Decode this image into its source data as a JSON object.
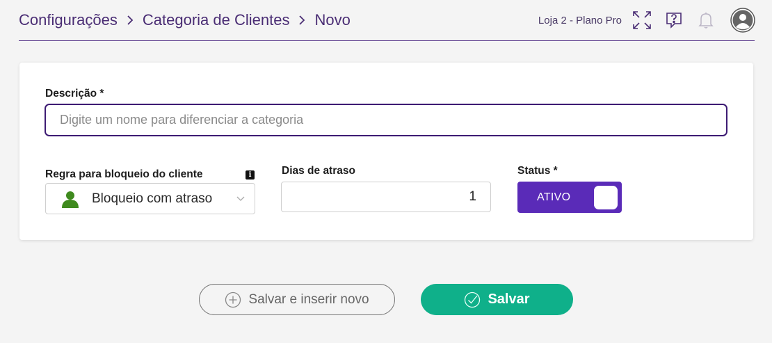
{
  "breadcrumb": {
    "items": [
      "Configurações",
      "Categoria de Clientes",
      "Novo"
    ]
  },
  "header": {
    "store_label": "Loja 2 - Plano Pro",
    "icons": [
      "fullscreen-icon",
      "help-icon",
      "bell-icon",
      "avatar-icon"
    ]
  },
  "form": {
    "description": {
      "label": "Descrição *",
      "placeholder": "Digite um nome para diferenciar a categoria",
      "value": ""
    },
    "block_rule": {
      "label": "Regra para bloqueio do cliente",
      "selected": "Bloqueio com atraso",
      "info_icon": "info-icon"
    },
    "delay_days": {
      "label": "Dias de atraso",
      "value": "1"
    },
    "status": {
      "label": "Status *",
      "toggle_label": "ATIVO",
      "on": true
    }
  },
  "actions": {
    "save_and_new": "Salvar e inserir novo",
    "save": "Salvar"
  },
  "colors": {
    "accent_purple": "#5a2bb8",
    "brand_dark_purple": "#3d1b73",
    "save_green": "#0fb08a",
    "person_icon_green": "#3f8a1e"
  }
}
